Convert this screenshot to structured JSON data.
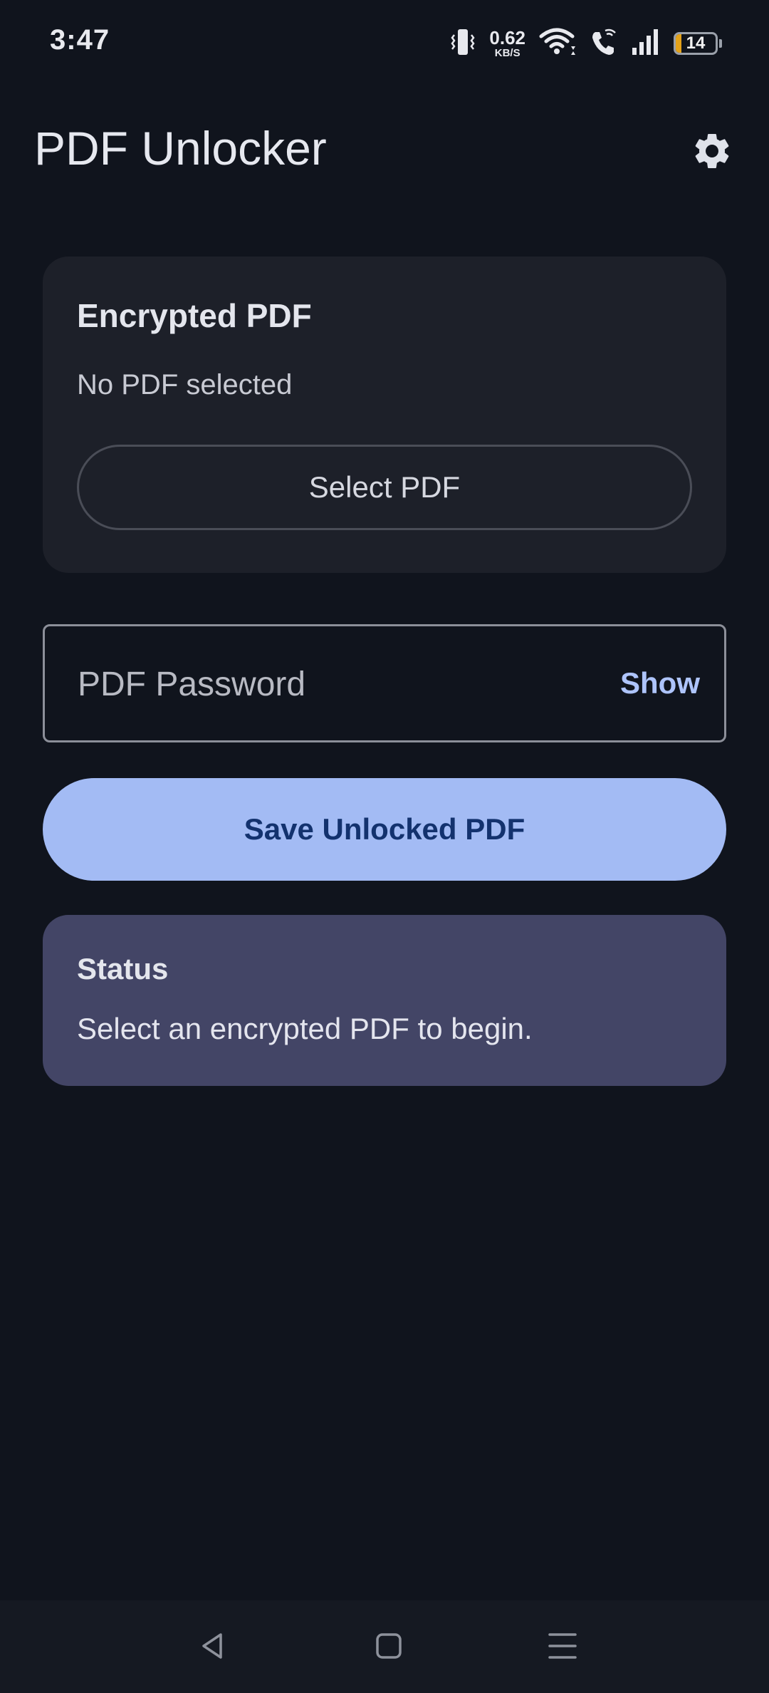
{
  "status_bar": {
    "time": "3:47",
    "net_speed_value": "0.62",
    "net_speed_unit": "KB/S",
    "battery_level": "14",
    "battery_fraction": 0.14,
    "battery_color": "#e3a21a",
    "icons": [
      "vibrate-icon",
      "wifi-icon",
      "wifi-call-icon",
      "cell-signal-icon",
      "battery-icon"
    ]
  },
  "app_bar": {
    "title": "PDF Unlocker",
    "settings_icon": "gear-icon"
  },
  "encrypted_card": {
    "title": "Encrypted PDF",
    "file_status": "No PDF selected",
    "select_button_label": "Select PDF"
  },
  "password_field": {
    "placeholder": "PDF Password",
    "value": "",
    "toggle_label": "Show"
  },
  "save_button": {
    "label": "Save Unlocked PDF"
  },
  "status_card": {
    "title": "Status",
    "message": "Select an encrypted PDF to begin."
  },
  "nav_bar": {
    "icons": [
      "back-icon",
      "home-icon",
      "menu-icon"
    ]
  },
  "colors": {
    "background": "#10141d",
    "card": "#1d2029",
    "accent": "#a3bbf4",
    "accent_text": "#13326e",
    "status_card": "#434566",
    "link": "#aec4fb"
  }
}
